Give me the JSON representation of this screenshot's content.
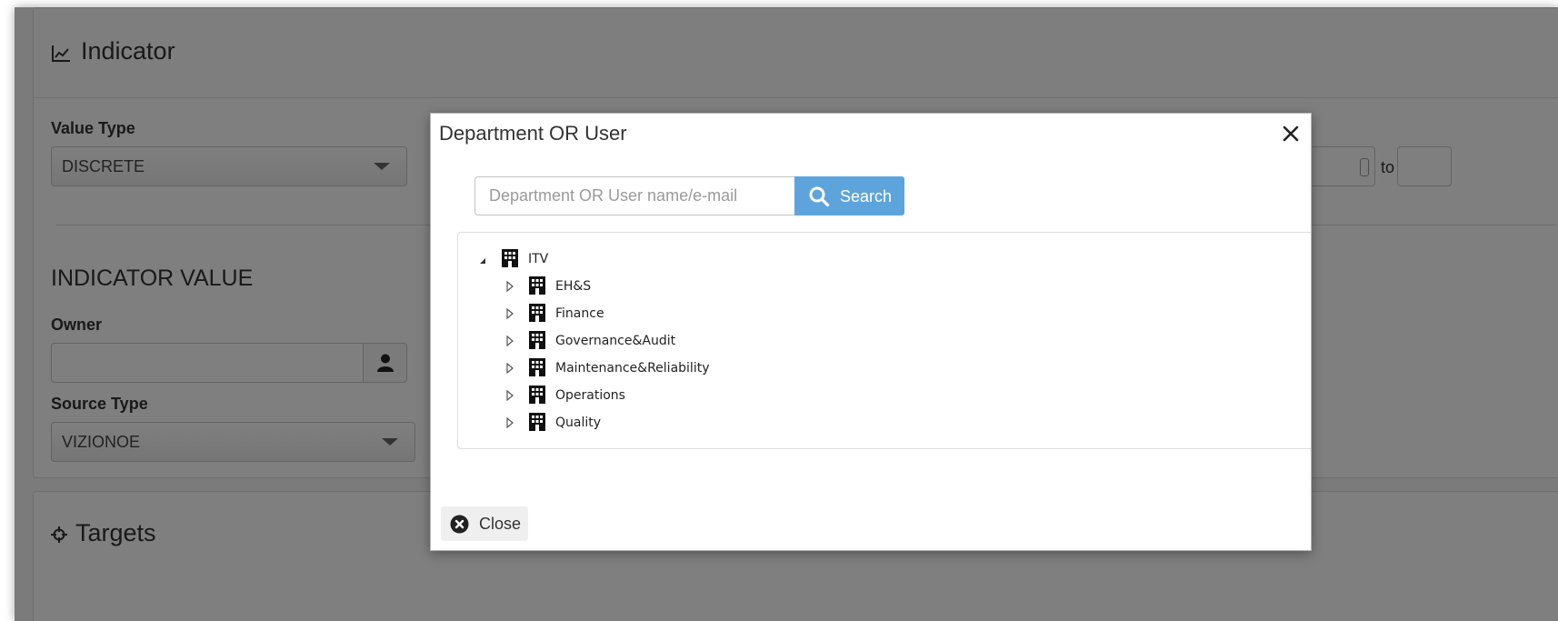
{
  "background": {
    "indicator_title": "Indicator",
    "value_type_label": "Value Type",
    "value_type_value": "DISCRETE",
    "indicator_value_heading": "INDICATOR VALUE",
    "owner_label": "Owner",
    "source_type_label": "Source Type",
    "source_type_value": "VIZIONOE",
    "range_to_label": "to",
    "targets_title": "Targets"
  },
  "modal": {
    "title": "Department OR User",
    "search": {
      "placeholder": "Department OR User name/e-mail",
      "value": "",
      "button_label": "Search"
    },
    "tree": {
      "root": {
        "label": "ITV",
        "expanded": true
      },
      "children": [
        {
          "label": "EH&S",
          "expanded": false
        },
        {
          "label": "Finance",
          "expanded": false
        },
        {
          "label": "Governance&Audit",
          "expanded": false
        },
        {
          "label": "Maintenance&Reliability",
          "expanded": false
        },
        {
          "label": "Operations",
          "expanded": false
        },
        {
          "label": "Quality",
          "expanded": false
        }
      ]
    },
    "close_label": "Close"
  },
  "colors": {
    "accent": "#5ea4dc",
    "overlay": "rgba(0,0,0,0.5)"
  },
  "icons": [
    "chart-line-icon",
    "close-x-icon",
    "search-icon",
    "building-icon",
    "user-icon",
    "crosshair-icon",
    "close-circle-icon",
    "caret-down-icon",
    "triangle-expanded-icon",
    "triangle-collapsed-icon"
  ]
}
